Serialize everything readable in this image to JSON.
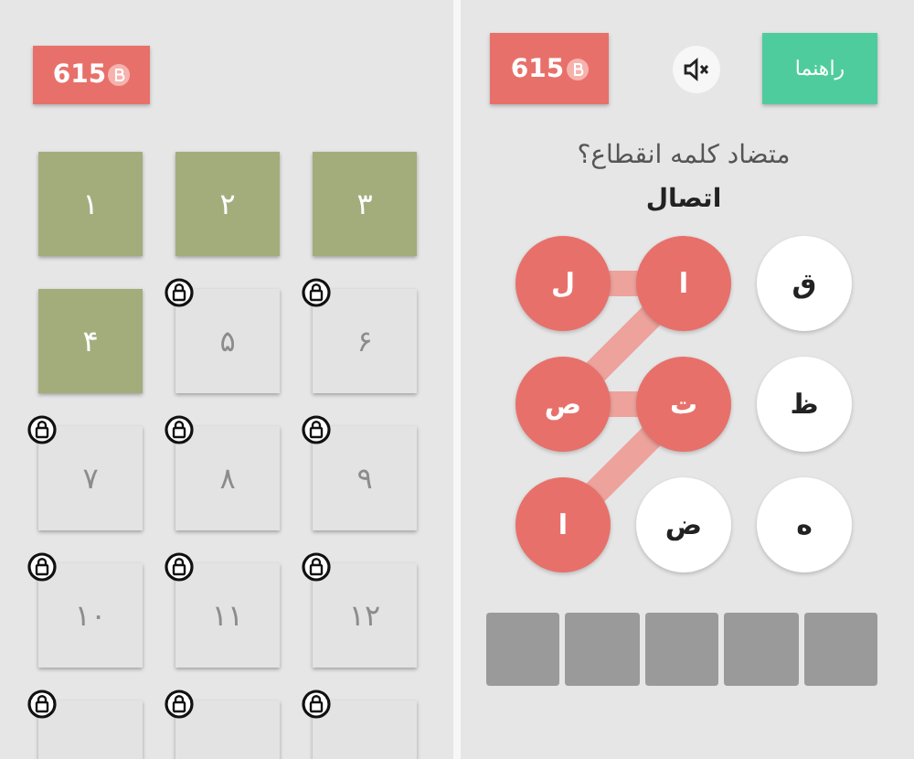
{
  "level_screen": {
    "coins": "615",
    "levels": [
      {
        "label": "۳",
        "locked": false
      },
      {
        "label": "۲",
        "locked": false
      },
      {
        "label": "۱",
        "locked": false
      },
      {
        "label": "۶",
        "locked": true
      },
      {
        "label": "۵",
        "locked": true
      },
      {
        "label": "۴",
        "locked": false
      },
      {
        "label": "۹",
        "locked": true
      },
      {
        "label": "۸",
        "locked": true
      },
      {
        "label": "۷",
        "locked": true
      },
      {
        "label": "۱۲",
        "locked": true
      },
      {
        "label": "۱۱",
        "locked": true
      },
      {
        "label": "۱۰",
        "locked": true
      },
      {
        "locked": true
      },
      {
        "locked": true
      },
      {
        "locked": true
      }
    ]
  },
  "game_screen": {
    "coins": "615",
    "muted": true,
    "hint_button": "راهنما",
    "question": "متضاد کلمه انقطاع؟",
    "answer": "اتصال",
    "letters": [
      {
        "letter": "ق",
        "selected": false,
        "link_left": false,
        "link_down_left": false
      },
      {
        "letter": "ا",
        "selected": true,
        "link_left": true,
        "link_down_left": true
      },
      {
        "letter": "ل",
        "selected": true,
        "link_left": false,
        "link_down_left": false
      },
      {
        "letter": "ظ",
        "selected": false,
        "link_left": false,
        "link_down_left": false
      },
      {
        "letter": "ت",
        "selected": true,
        "link_left": true,
        "link_down_left": true
      },
      {
        "letter": "ص",
        "selected": true,
        "link_left": false,
        "link_down_left": false
      },
      {
        "letter": "ه",
        "selected": false,
        "link_left": false,
        "link_down_left": false
      },
      {
        "letter": "ض",
        "selected": false,
        "link_left": false,
        "link_down_left": false
      },
      {
        "letter": "ا",
        "selected": true,
        "link_left": false,
        "link_down_left": false
      }
    ],
    "answer_slots": [
      {
        "filled": false
      },
      {
        "filled": false
      },
      {
        "filled": false
      },
      {
        "filled": false
      },
      {
        "filled": false
      }
    ]
  }
}
